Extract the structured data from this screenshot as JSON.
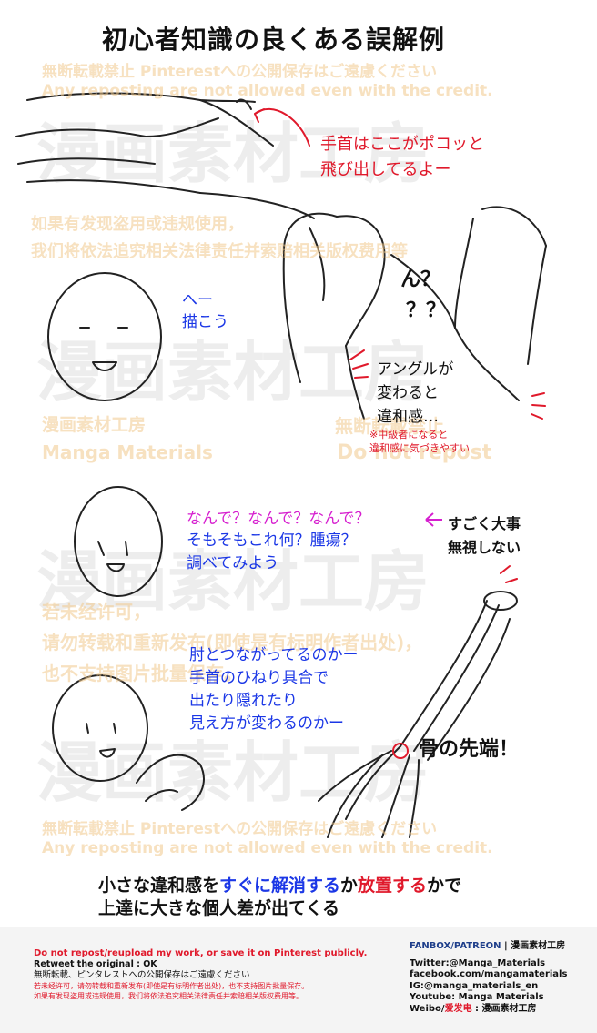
{
  "title": "初心者知識の良くある誤解例",
  "watermarks": {
    "jp1": "無断転載禁止 Pinterestへの公開保存はご遠慮ください",
    "en1": "Any reposting are not allowed even with the credit.",
    "cn1": "如果有发现盗用或违规使用，",
    "cn2": "我们将依法追究相关法律责任并索赔相关版权费用等",
    "jp_studio": "漫画素材工房",
    "en_studio": "Manga Materials",
    "no_repost_jp": "無断転載禁止",
    "no_repost_en": "Do not repost",
    "cn3": "若未经许可，",
    "cn4": "请勿转载和重新发布(即使是有标明作者出处)，",
    "cn5": "也不支持图片批量保存。",
    "jp2": "無断転載禁止 Pinterestへの公開保存はご遠慮ください",
    "en2": "Any reposting are not allowed even with the credit."
  },
  "panel1": {
    "note_line1": "手首はここがポコッと",
    "note_line2": "飛び出してるよー"
  },
  "panel2": {
    "hee": "へー",
    "kakou": "描こう",
    "n_q": "ん？",
    "qq": "？？",
    "angle_line1": "アングルが",
    "angle_line2": "変わると",
    "angle_line3": "違和感…",
    "small_line1": "※中級者になると",
    "small_line2": "違和感に気づきやすい"
  },
  "panel3": {
    "line1": "なんで？なんで？なんで？",
    "line2": "そもそもこれ何？腫瘍？",
    "line3": "調べてみよう",
    "important1": "すごく大事",
    "important2": "無視しない"
  },
  "panel4": {
    "line1": "肘とつながってるのかー",
    "line2": "手首のひねり具合で",
    "line3": "出たり隠れたり",
    "line4": "見え方が変わるのかー",
    "bone_tip": "骨の先端！"
  },
  "conclusion": {
    "l1_a": "小さな違和感を",
    "l1_b": "すぐに解消する",
    "l1_c": "か",
    "l1_d": "放置する",
    "l1_e": "かで",
    "l2": "上達に大きな個人差が出てくる"
  },
  "footer": {
    "left": {
      "red_en": "Do not repost/reupload my work, or save it on Pinterest publicly.",
      "retweet": "Retweet the original : OK",
      "jp": "無断転載、ピンタレストへの公開保存はご遠慮ください",
      "cn_a": "若未经许可，请勿转载和重新发布(即使是有标明作者出处)，也不支持图片批量保存。",
      "cn_b": "如果有发现盗用或违规使用，我们将依法追究相关法律责任并索赔相关版权费用等。"
    },
    "right": {
      "fanbox": "FANBOX/PATREON",
      "sep": " | ",
      "studio": "漫画素材工房",
      "twitter": "Twitter:@Manga_Materials",
      "facebook": "facebook.com/mangamaterials",
      "ig": "IG:@manga_materials_en",
      "youtube": "Youtube: Manga Materials",
      "weibo_a": "Weibo/",
      "weibo_b": "爱发电",
      "weibo_c": " : 漫画素材工房"
    }
  },
  "colors": {
    "red": "#e0192b",
    "blue": "#1b37e6",
    "magenta": "#d61fcf",
    "watermark": "#f0c88c"
  }
}
